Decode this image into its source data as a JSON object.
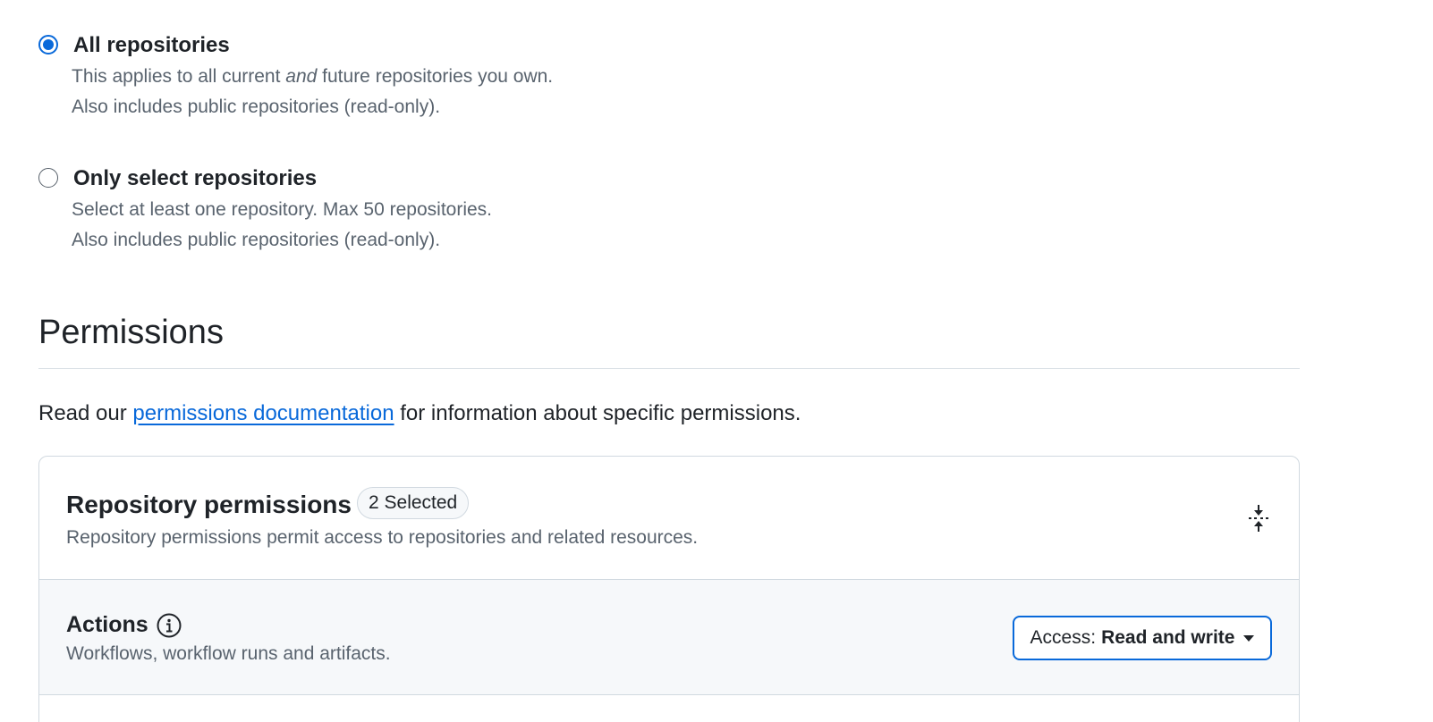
{
  "repository_access": {
    "options": [
      {
        "label": "All repositories",
        "checked": true,
        "desc_line1_pre": "This applies to all current ",
        "desc_line1_em": "and",
        "desc_line1_post": " future repositories you own.",
        "desc_line2": "Also includes public repositories (read-only)."
      },
      {
        "label": "Only select repositories",
        "checked": false,
        "desc_line1": "Select at least one repository. Max 50 repositories.",
        "desc_line2": "Also includes public repositories (read-only)."
      }
    ]
  },
  "permissions": {
    "title": "Permissions",
    "intro_pre": "Read our ",
    "intro_link": "permissions documentation",
    "intro_post": " for information about specific permissions."
  },
  "repository_permissions": {
    "title": "Repository permissions",
    "badge": "2 Selected",
    "description": "Repository permissions permit access to repositories and related resources.",
    "collapse_icon": "fold-icon",
    "rows": [
      {
        "title": "Actions",
        "icon": "info-icon",
        "description": "Workflows, workflow runs and artifacts.",
        "access_prefix": "Access:",
        "access_value": "Read and write"
      }
    ]
  },
  "colors": {
    "accent": "#0969da",
    "text": "#1f2328",
    "muted": "#59636e",
    "border": "#d1d9e0",
    "row_bg": "#f6f8fa"
  }
}
